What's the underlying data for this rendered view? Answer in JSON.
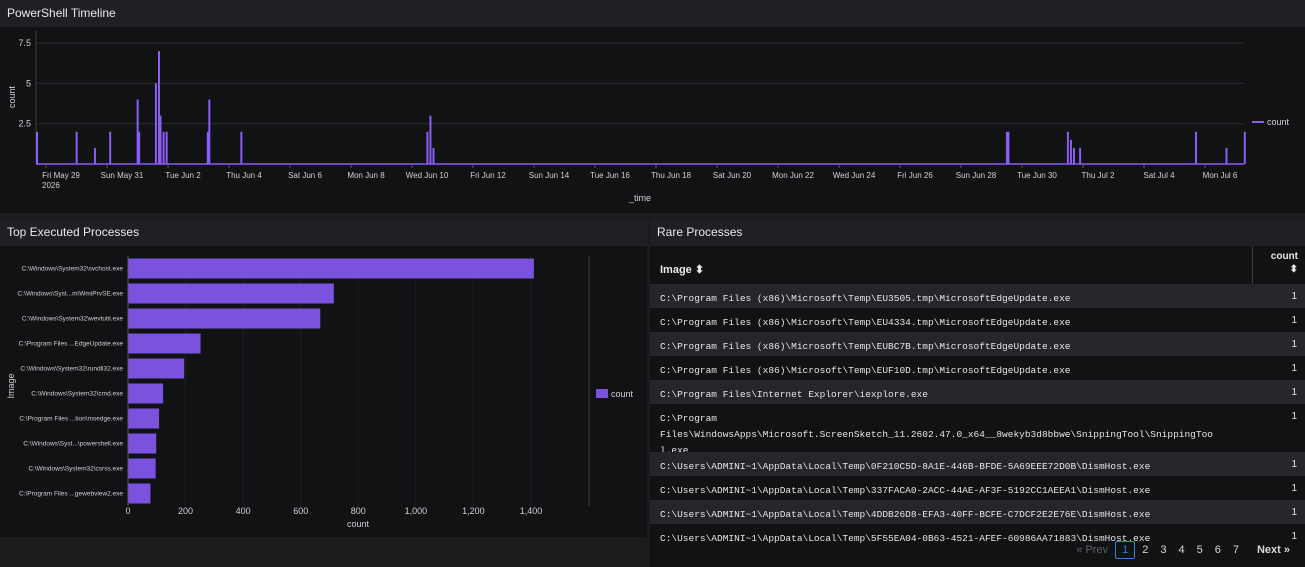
{
  "timeline": {
    "title": "PowerShell Timeline",
    "chart_data": {
      "type": "bar",
      "xlabel": "_time",
      "ylabel": "count",
      "yticks": [
        "7.5",
        "5",
        "2.5"
      ],
      "ylim": [
        0,
        8.5
      ],
      "xtick_labels": [
        "Fri May 29",
        "Sun May 31",
        "Tue Jun 2",
        "Thu Jun 4",
        "Sat Jun 6",
        "Mon Jun 8",
        "Wed Jun 10",
        "Fri Jun 12",
        "Sun Jun 14",
        "Tue Jun 16",
        "Thu Jun 18",
        "Sat Jun 20",
        "Mon Jun 22",
        "Wed Jun 24",
        "Fri Jun 26",
        "Sun Jun 28",
        "Tue Jun 30",
        "Thu Jul 2",
        "Sat Jul 4",
        "Mon Jul 6"
      ],
      "year_label": "2026",
      "legend": "count",
      "series": [
        {
          "name": "count",
          "points": [
            {
              "day": 0.0,
              "value": 2
            },
            {
              "day": 1.3,
              "value": 2
            },
            {
              "day": 1.9,
              "value": 1
            },
            {
              "day": 2.4,
              "value": 2
            },
            {
              "day": 3.3,
              "value": 4
            },
            {
              "day": 3.35,
              "value": 2
            },
            {
              "day": 3.9,
              "value": 5
            },
            {
              "day": 4.0,
              "value": 7
            },
            {
              "day": 4.05,
              "value": 3
            },
            {
              "day": 4.15,
              "value": 2
            },
            {
              "day": 4.25,
              "value": 2
            },
            {
              "day": 5.6,
              "value": 2
            },
            {
              "day": 5.65,
              "value": 4
            },
            {
              "day": 6.7,
              "value": 2
            },
            {
              "day": 12.8,
              "value": 2
            },
            {
              "day": 12.9,
              "value": 3
            },
            {
              "day": 13.0,
              "value": 1
            },
            {
              "day": 31.8,
              "value": 2
            },
            {
              "day": 31.85,
              "value": 2
            },
            {
              "day": 33.8,
              "value": 2
            },
            {
              "day": 33.9,
              "value": 1.5
            },
            {
              "day": 34.0,
              "value": 1
            },
            {
              "day": 34.2,
              "value": 1
            },
            {
              "day": 38.0,
              "value": 2
            },
            {
              "day": 39.0,
              "value": 1
            },
            {
              "day": 39.6,
              "value": 2
            }
          ]
        }
      ]
    }
  },
  "top_processes": {
    "title": "Top Executed Processes",
    "chart_data": {
      "type": "bar",
      "orientation": "horizontal",
      "xlabel": "count",
      "ylabel": "Image",
      "xlim": [
        0,
        1500
      ],
      "xticks": [
        "0",
        "200",
        "400",
        "600",
        "800",
        "1,000",
        "1,200",
        "1,400"
      ],
      "legend": "count",
      "color": "#7b52de",
      "categories": [
        "C:\\Windows\\System32\\svchost.exe",
        "C:\\Windows\\Syst...m\\WmiPrvSE.exe",
        "C:\\Windows\\System32\\wevtutil.exe",
        "C:\\Program Files ...EdgeUpdate.exe",
        "C:\\Windows\\System32\\rundll32.exe",
        "C:\\Windows\\System32\\cmd.exe",
        "C:\\Program Files ...tion\\msedge.exe",
        "C:\\Windows\\Syst...\\powershell.exe",
        "C:\\Windows\\System32\\csrss.exe",
        "C:\\Program Files ...gewebview2.exe"
      ],
      "values": [
        1410,
        715,
        668,
        252,
        195,
        122,
        108,
        98,
        96,
        78
      ]
    }
  },
  "rare_processes": {
    "title": "Rare Processes",
    "col_image": "Image",
    "col_count": "count",
    "sort_icon": "sort-icon",
    "rows": [
      {
        "image": "C:\\Program Files (x86)\\Microsoft\\Temp\\EU3505.tmp\\MicrosoftEdgeUpdate.exe",
        "count": "1"
      },
      {
        "image": "C:\\Program Files (x86)\\Microsoft\\Temp\\EU4334.tmp\\MicrosoftEdgeUpdate.exe",
        "count": "1"
      },
      {
        "image": "C:\\Program Files (x86)\\Microsoft\\Temp\\EUBC7B.tmp\\MicrosoftEdgeUpdate.exe",
        "count": "1"
      },
      {
        "image": "C:\\Program Files (x86)\\Microsoft\\Temp\\EUF10D.tmp\\MicrosoftEdgeUpdate.exe",
        "count": "1"
      },
      {
        "image": "C:\\Program Files\\Internet Explorer\\iexplore.exe",
        "count": "1"
      },
      {
        "image": "C:\\Program\nFiles\\WindowsApps\\Microsoft.ScreenSketch_11.2602.47.0_x64__8wekyb3d8bbwe\\SnippingTool\\SnippingTool.exe",
        "count": "1"
      },
      {
        "image": "C:\\Users\\ADMINI~1\\AppData\\Local\\Temp\\0F210C5D-8A1E-446B-BFDE-5A69EEE72D0B\\DismHost.exe",
        "count": "1"
      },
      {
        "image": "C:\\Users\\ADMINI~1\\AppData\\Local\\Temp\\337FACA0-2ACC-44AE-AF3F-5192CC1AEEA1\\DismHost.exe",
        "count": "1"
      },
      {
        "image": "C:\\Users\\ADMINI~1\\AppData\\Local\\Temp\\4DDB26D8-EFA3-40FF-BCFE-C7DCF2E2E76E\\DismHost.exe",
        "count": "1"
      },
      {
        "image": "C:\\Users\\ADMINI~1\\AppData\\Local\\Temp\\5F55EA04-0B63-4521-AFEF-60986AA71883\\DismHost.exe",
        "count": "1"
      }
    ],
    "pager": {
      "prev": "« Prev",
      "pages": [
        "1",
        "2",
        "3",
        "4",
        "5",
        "6",
        "7"
      ],
      "current": "1",
      "next": "Next »"
    }
  }
}
